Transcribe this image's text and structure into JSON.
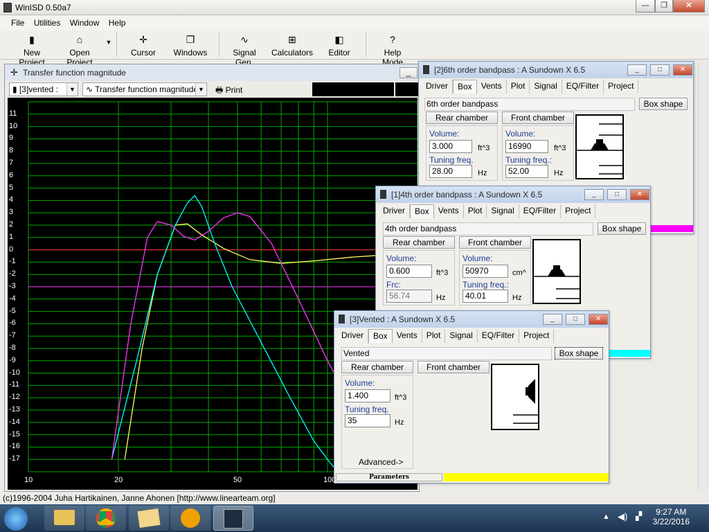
{
  "app": {
    "title": "WinISD 0.50a7"
  },
  "menu": [
    "File",
    "Utilities",
    "Window",
    "Help"
  ],
  "toolbar": {
    "new_project": "New Project",
    "open_project": "Open Project",
    "cursor": "Cursor",
    "windows": "Windows",
    "signal_gen": "Signal Gen.",
    "calculators": "Calculators",
    "editor": "Editor",
    "help_mode": "Help Mode"
  },
  "tf_window": {
    "title": "Transfer function magnitude",
    "project_select": "[3]vented :",
    "plot_select": "Transfer function magnitude",
    "print": "Print"
  },
  "chart_data": {
    "type": "line",
    "title": "Transfer function magnitude",
    "xlabel": "",
    "ylabel": "",
    "x_scale": "log",
    "xlim": [
      10,
      200
    ],
    "ylim": [
      -18,
      12
    ],
    "x_ticks": [
      10,
      20,
      50,
      100
    ],
    "y_ticks": [
      11,
      10,
      9,
      8,
      7,
      6,
      5,
      4,
      3,
      2,
      1,
      0,
      -1,
      -2,
      -3,
      -4,
      -5,
      -6,
      -7,
      -8,
      -9,
      -10,
      -11,
      -12,
      -13,
      -14,
      -15,
      -16,
      -17
    ],
    "grid": true,
    "reference_lines": [
      {
        "y": 0,
        "color": "#ff2b2b"
      },
      {
        "y": -3,
        "color": "#ff33ff"
      }
    ],
    "series": [
      {
        "color": "#ffff66",
        "x": [
          21,
          24,
          27,
          31,
          34,
          38,
          45,
          55,
          70,
          90,
          120,
          160,
          200
        ],
        "y": [
          -17,
          -8,
          -2,
          2,
          2.1,
          1.2,
          0.1,
          -0.8,
          -1.1,
          -0.9,
          -0.6,
          -0.4,
          -0.3
        ]
      },
      {
        "color": "#00ffff",
        "x": [
          19,
          23,
          27,
          31,
          34,
          36,
          38,
          42,
          48,
          60,
          75,
          90,
          100,
          108
        ],
        "y": [
          -17,
          -9,
          -2,
          2,
          3.8,
          4.4,
          3.5,
          0.5,
          -3,
          -7.5,
          -12,
          -15.5,
          -17,
          -18
        ]
      },
      {
        "color": "#ff33ff",
        "x": [
          19,
          22,
          25,
          27,
          30,
          33,
          36,
          40,
          45,
          50,
          55,
          65,
          80,
          100,
          130,
          160
        ],
        "y": [
          -17,
          -6,
          1,
          2.3,
          2,
          1.1,
          0.8,
          1.5,
          2.6,
          3,
          2.7,
          0.5,
          -4,
          -9,
          -14,
          -17
        ]
      }
    ]
  },
  "win6": {
    "title": "[2]6th order bandpass : A Sundown X 6.5",
    "tabs": [
      "Driver",
      "Box",
      "Vents",
      "Plot",
      "Signal",
      "EQ/Filter",
      "Project"
    ],
    "box_type": "6th order bandpass",
    "box_shape_btn": "Box shape",
    "rear_btn": "Rear chamber",
    "front_btn": "Front chamber",
    "rear_volume_label": "Volume:",
    "rear_volume": "3.000",
    "rear_volume_unit": "ft^3",
    "rear_tuning_label": "Tuning freq.",
    "rear_tuning": "28.00",
    "rear_tuning_unit": "Hz",
    "front_volume_label": "Volume:",
    "front_volume": "16990",
    "front_volume_unit": "ft^3",
    "front_tuning_label": "Tuning freq.:",
    "front_tuning": "52.00",
    "front_tuning_unit": "Hz",
    "status_color": "#ff00ff"
  },
  "win4": {
    "title": "[1]4th order bandpass : A Sundown X 6.5",
    "tabs": [
      "Driver",
      "Box",
      "Vents",
      "Plot",
      "Signal",
      "EQ/Filter",
      "Project"
    ],
    "box_type": "4th order bandpass",
    "box_shape_btn": "Box shape",
    "rear_btn": "Rear chamber",
    "front_btn": "Front chamber",
    "rear_volume_label": "Volume:",
    "rear_volume": "0.600",
    "rear_volume_unit": "ft^3",
    "frc_label": "Frc:",
    "frc": "56.74",
    "frc_unit": "Hz",
    "front_volume_label": "Volume:",
    "front_volume": "50970",
    "front_volume_unit": "cm^",
    "front_tuning_label": "Tuning freq.:",
    "front_tuning": "40.01",
    "front_tuning_unit": "Hz",
    "status_color": "#00ffff"
  },
  "win3": {
    "title": "[3]Vented : A Sundown X 6.5",
    "tabs": [
      "Driver",
      "Box",
      "Vents",
      "Plot",
      "Signal",
      "EQ/Filter",
      "Project"
    ],
    "box_type": "Vented",
    "box_shape_btn": "Box shape",
    "rear_btn": "Rear chamber",
    "front_btn": "Front chamber",
    "volume_label": "Volume:",
    "volume": "1.400",
    "volume_unit": "ft^3",
    "tuning_label": "Tuning freq.",
    "tuning": "35",
    "tuning_unit": "Hz",
    "advanced": "Advanced->",
    "status_label": "Parameters",
    "status_color": "#ffff00"
  },
  "statusbar": {
    "copyright": "(c)1996-2004 Juha Hartikainen, Janne Ahonen [http://www.linearteam.org]"
  },
  "taskbar": {
    "time": "9:27 AM",
    "date": "3/22/2016"
  }
}
